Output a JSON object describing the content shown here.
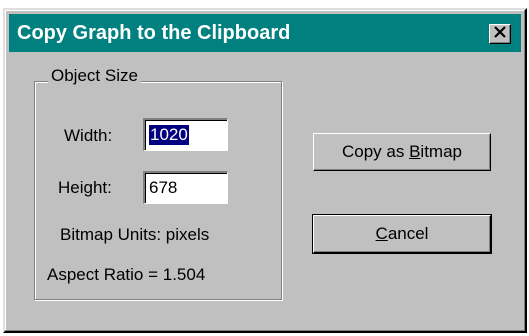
{
  "window": {
    "title": "Copy Graph to the Clipboard",
    "close_glyph": "✕"
  },
  "object_size": {
    "legend": "Object Size",
    "width_label": "Width:",
    "width_value": "1020",
    "height_label": "Height:",
    "height_value": "678",
    "units_text": "Bitmap Units: pixels",
    "aspect_text": "Aspect Ratio = 1.504"
  },
  "buttons": {
    "copy_bitmap": {
      "before": "Copy as ",
      "mnemonic": "B",
      "after": "itmap"
    },
    "cancel": {
      "before": "",
      "mnemonic": "C",
      "after": "ancel"
    }
  },
  "colors": {
    "titlebar": "#00807f",
    "dialog_bg": "#c0c0c0",
    "selection": "#000080"
  }
}
